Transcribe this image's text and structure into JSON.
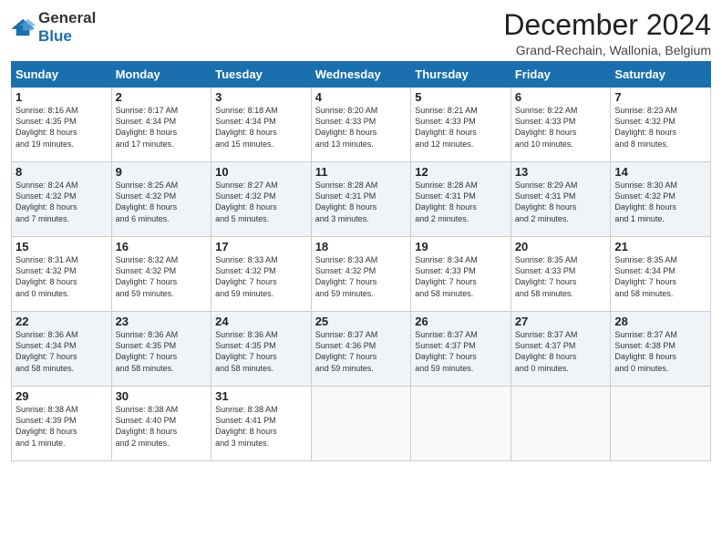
{
  "logo": {
    "general": "General",
    "blue": "Blue"
  },
  "title": "December 2024",
  "subtitle": "Grand-Rechain, Wallonia, Belgium",
  "headers": [
    "Sunday",
    "Monday",
    "Tuesday",
    "Wednesday",
    "Thursday",
    "Friday",
    "Saturday"
  ],
  "weeks": [
    [
      {
        "day": "1",
        "info": "Sunrise: 8:16 AM\nSunset: 4:35 PM\nDaylight: 8 hours\nand 19 minutes."
      },
      {
        "day": "2",
        "info": "Sunrise: 8:17 AM\nSunset: 4:34 PM\nDaylight: 8 hours\nand 17 minutes."
      },
      {
        "day": "3",
        "info": "Sunrise: 8:18 AM\nSunset: 4:34 PM\nDaylight: 8 hours\nand 15 minutes."
      },
      {
        "day": "4",
        "info": "Sunrise: 8:20 AM\nSunset: 4:33 PM\nDaylight: 8 hours\nand 13 minutes."
      },
      {
        "day": "5",
        "info": "Sunrise: 8:21 AM\nSunset: 4:33 PM\nDaylight: 8 hours\nand 12 minutes."
      },
      {
        "day": "6",
        "info": "Sunrise: 8:22 AM\nSunset: 4:33 PM\nDaylight: 8 hours\nand 10 minutes."
      },
      {
        "day": "7",
        "info": "Sunrise: 8:23 AM\nSunset: 4:32 PM\nDaylight: 8 hours\nand 8 minutes."
      }
    ],
    [
      {
        "day": "8",
        "info": "Sunrise: 8:24 AM\nSunset: 4:32 PM\nDaylight: 8 hours\nand 7 minutes."
      },
      {
        "day": "9",
        "info": "Sunrise: 8:25 AM\nSunset: 4:32 PM\nDaylight: 8 hours\nand 6 minutes."
      },
      {
        "day": "10",
        "info": "Sunrise: 8:27 AM\nSunset: 4:32 PM\nDaylight: 8 hours\nand 5 minutes."
      },
      {
        "day": "11",
        "info": "Sunrise: 8:28 AM\nSunset: 4:31 PM\nDaylight: 8 hours\nand 3 minutes."
      },
      {
        "day": "12",
        "info": "Sunrise: 8:28 AM\nSunset: 4:31 PM\nDaylight: 8 hours\nand 2 minutes."
      },
      {
        "day": "13",
        "info": "Sunrise: 8:29 AM\nSunset: 4:31 PM\nDaylight: 8 hours\nand 2 minutes."
      },
      {
        "day": "14",
        "info": "Sunrise: 8:30 AM\nSunset: 4:32 PM\nDaylight: 8 hours\nand 1 minute."
      }
    ],
    [
      {
        "day": "15",
        "info": "Sunrise: 8:31 AM\nSunset: 4:32 PM\nDaylight: 8 hours\nand 0 minutes."
      },
      {
        "day": "16",
        "info": "Sunrise: 8:32 AM\nSunset: 4:32 PM\nDaylight: 7 hours\nand 59 minutes."
      },
      {
        "day": "17",
        "info": "Sunrise: 8:33 AM\nSunset: 4:32 PM\nDaylight: 7 hours\nand 59 minutes."
      },
      {
        "day": "18",
        "info": "Sunrise: 8:33 AM\nSunset: 4:32 PM\nDaylight: 7 hours\nand 59 minutes."
      },
      {
        "day": "19",
        "info": "Sunrise: 8:34 AM\nSunset: 4:33 PM\nDaylight: 7 hours\nand 58 minutes."
      },
      {
        "day": "20",
        "info": "Sunrise: 8:35 AM\nSunset: 4:33 PM\nDaylight: 7 hours\nand 58 minutes."
      },
      {
        "day": "21",
        "info": "Sunrise: 8:35 AM\nSunset: 4:34 PM\nDaylight: 7 hours\nand 58 minutes."
      }
    ],
    [
      {
        "day": "22",
        "info": "Sunrise: 8:36 AM\nSunset: 4:34 PM\nDaylight: 7 hours\nand 58 minutes."
      },
      {
        "day": "23",
        "info": "Sunrise: 8:36 AM\nSunset: 4:35 PM\nDaylight: 7 hours\nand 58 minutes."
      },
      {
        "day": "24",
        "info": "Sunrise: 8:36 AM\nSunset: 4:35 PM\nDaylight: 7 hours\nand 58 minutes."
      },
      {
        "day": "25",
        "info": "Sunrise: 8:37 AM\nSunset: 4:36 PM\nDaylight: 7 hours\nand 59 minutes."
      },
      {
        "day": "26",
        "info": "Sunrise: 8:37 AM\nSunset: 4:37 PM\nDaylight: 7 hours\nand 59 minutes."
      },
      {
        "day": "27",
        "info": "Sunrise: 8:37 AM\nSunset: 4:37 PM\nDaylight: 8 hours\nand 0 minutes."
      },
      {
        "day": "28",
        "info": "Sunrise: 8:37 AM\nSunset: 4:38 PM\nDaylight: 8 hours\nand 0 minutes."
      }
    ],
    [
      {
        "day": "29",
        "info": "Sunrise: 8:38 AM\nSunset: 4:39 PM\nDaylight: 8 hours\nand 1 minute."
      },
      {
        "day": "30",
        "info": "Sunrise: 8:38 AM\nSunset: 4:40 PM\nDaylight: 8 hours\nand 2 minutes."
      },
      {
        "day": "31",
        "info": "Sunrise: 8:38 AM\nSunset: 4:41 PM\nDaylight: 8 hours\nand 3 minutes."
      },
      null,
      null,
      null,
      null
    ]
  ]
}
